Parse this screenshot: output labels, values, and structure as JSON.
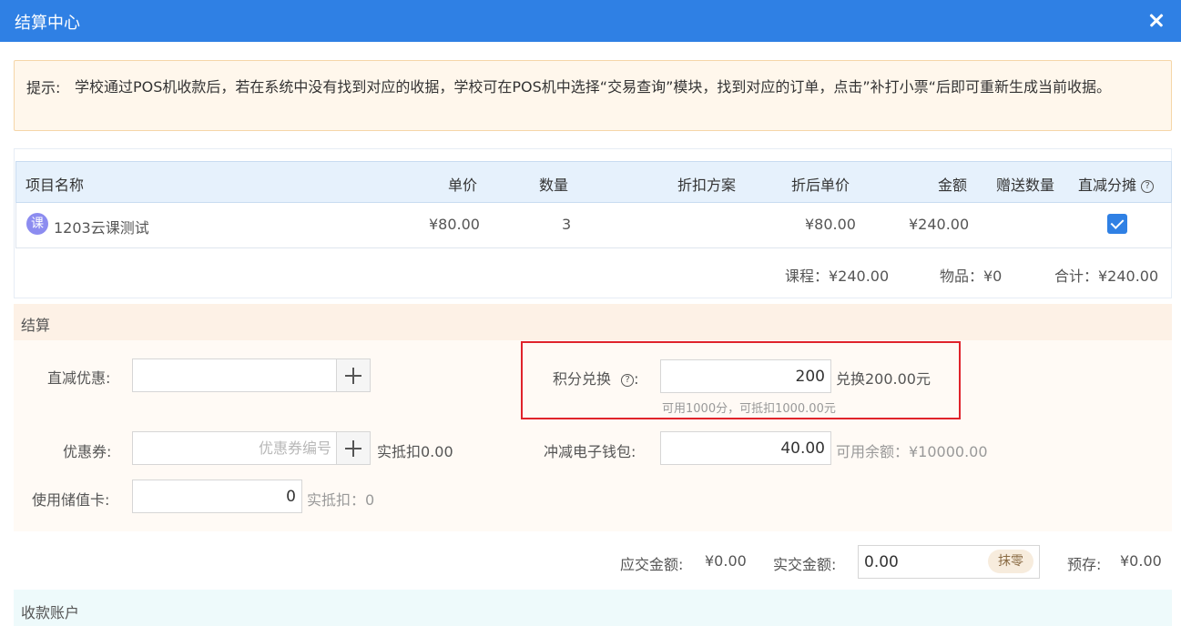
{
  "header": {
    "title": "结算中心"
  },
  "notice": {
    "label": "提示:",
    "text": "学校通过POS机收款后，若在系统中没有找到对应的收据，学校可在POS机中选择“交易查询”模块，找到对应的订单，点击”补打小票“后即可重新生成当前收据。"
  },
  "table": {
    "columns": {
      "name": "项目名称",
      "unit_price": "单价",
      "quantity": "数量",
      "discount_plan": "折扣方案",
      "discounted_price": "折后单价",
      "amount": "金额",
      "gift_qty": "赠送数量",
      "direct_split": "直减分摊"
    },
    "rows": [
      {
        "badge": "课",
        "name": "1203云课测试",
        "unit_price": "¥80.00",
        "quantity": "3",
        "discount_plan": "",
        "discounted_price": "¥80.00",
        "amount": "¥240.00",
        "gift_qty": "",
        "direct_split_checked": true
      }
    ],
    "summary": {
      "course": "课程：¥240.00",
      "goods": "物品：¥0",
      "total": "合计：¥240.00"
    }
  },
  "settlement": {
    "title": "结算",
    "direct_discount": {
      "label": "直减优惠:",
      "value": ""
    },
    "points": {
      "label": "积分兑换",
      "suffix": ":",
      "value": "200",
      "exchange_text": "兑换200.00元",
      "hint": "可用1000分，可抵扣1000.00元"
    },
    "coupon": {
      "label": "优惠券:",
      "placeholder": "优惠券编号",
      "deduct_text": "实抵扣0.00"
    },
    "wallet": {
      "label": "冲减电子钱包:",
      "value": "40.00",
      "balance_text": "可用余额：¥10000.00"
    },
    "stored_card": {
      "label": "使用储值卡:",
      "value": "0",
      "deduct_text": "实抵扣：0"
    }
  },
  "payment": {
    "due_label": "应交金额:",
    "due_value": "¥0.00",
    "paid_label": "实交金额:",
    "paid_value": "0.00",
    "round_label": "抹零",
    "prepaid_label": "预存:",
    "prepaid_value": "¥0.00"
  },
  "account": {
    "title": "收款账户"
  },
  "colors": {
    "primary": "#2f80e4",
    "danger": "#e0232b",
    "success": "#1a9a3a"
  },
  "icons": {
    "close": "close-icon",
    "help": "help-circle-icon",
    "plus": "plus-icon",
    "check": "checkmark-icon"
  }
}
